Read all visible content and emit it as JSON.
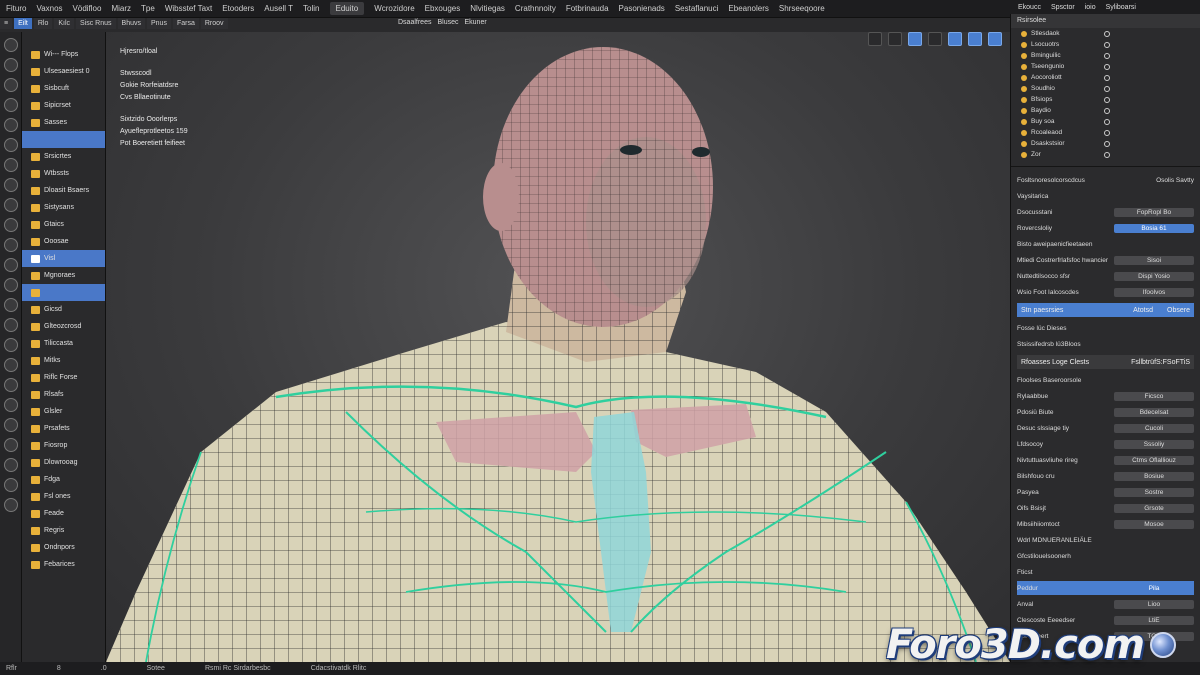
{
  "menubar": {
    "items": [
      "Fituro",
      "Vaxnos",
      "Vödifloo",
      "Miarz",
      "Tpe",
      "Wibsstef Taxt",
      "Etooders",
      "Ausell T",
      "Tolin",
      "Eduito",
      "Wcrozidore",
      "Ebxouges",
      "Nlvitiegas",
      "Crathnnoity",
      "Fotbrinauda",
      "Pasonienads",
      "Sestaflanuci",
      "Ebeanolers",
      "Shrseeqoore"
    ]
  },
  "toolbar2": {
    "tabs": [
      "≡",
      "Eilt",
      "Rlo",
      "Kılc",
      "Sisc Rnus",
      "Bhuvs",
      "Pnus",
      "Farsa",
      "Rroov"
    ],
    "header": [
      "Dsaalfrees",
      "Blusec",
      "Ekuner"
    ]
  },
  "viewport": {
    "text_block_1": [
      "Hjresro/tloal"
    ],
    "text_block_2": [
      "Stwsscodl",
      "Gokie Rorfeiatdsre",
      "Cvs Bllaeotinute"
    ],
    "text_block_3": [
      "Sixtzido Ooorlerps",
      "Ayuefleprotleetos 159",
      "Pot Boeretiett feifieet"
    ]
  },
  "outliner": {
    "items": [
      {
        "label": "Wi--- Flops",
        "state": "normal"
      },
      {
        "label": "Ulsesaesiest 0",
        "state": "normal"
      },
      {
        "label": "Sisbcuft",
        "state": "normal"
      },
      {
        "label": "Sipicrset",
        "state": "normal"
      },
      {
        "label": "Sasses",
        "state": "normal"
      },
      {
        "label": "",
        "state": "empty"
      },
      {
        "label": "Srsicrtes",
        "state": "normal"
      },
      {
        "label": "Wtbssts",
        "state": "normal"
      },
      {
        "label": "Dloasit Bsaers",
        "state": "normal"
      },
      {
        "label": "Sistysans",
        "state": "normal"
      },
      {
        "label": "Gtaics",
        "state": "normal"
      },
      {
        "label": "Ooosae",
        "state": "normal"
      },
      {
        "label": "Visl",
        "state": "selected"
      },
      {
        "label": "Mgnoraes",
        "state": "normal"
      },
      {
        "label": "",
        "state": "empty"
      },
      {
        "label": "Gicsd",
        "state": "normal"
      },
      {
        "label": "Glteozcrosd",
        "state": "normal"
      },
      {
        "label": "Tiliccasta",
        "state": "normal"
      },
      {
        "label": "Mitks",
        "state": "normal"
      },
      {
        "label": "Riflc Forse",
        "state": "normal"
      },
      {
        "label": "Rlsafs",
        "state": "normal"
      },
      {
        "label": "Glsler",
        "state": "normal"
      },
      {
        "label": "Prsafets",
        "state": "normal"
      },
      {
        "label": "Fiosrop",
        "state": "normal"
      },
      {
        "label": "Dlowrooag",
        "state": "normal"
      },
      {
        "label": "Fdga",
        "state": "normal"
      },
      {
        "label": "Fsl ones",
        "state": "normal"
      },
      {
        "label": "Feade",
        "state": "normal"
      },
      {
        "label": "Regris",
        "state": "normal"
      },
      {
        "label": "Ondnpors",
        "state": "normal"
      },
      {
        "label": "Febarices",
        "state": "normal"
      }
    ]
  },
  "rightpanel": {
    "top": [
      "Ekoucc",
      "Spsctor",
      "ioio",
      "Syliboarsi"
    ],
    "header": "Rsirsolee",
    "scene_items": [
      "Stlesdaok",
      "Lsocuotrs",
      "Bminguilic",
      "Tseengunio",
      "Aocoroliott",
      "Soudhio",
      "Bfsiops",
      "Baydio",
      "Buy soa",
      "Rcoaleaod",
      "Dsaskstsior",
      "Zor"
    ],
    "section_title_left": "Fosltsnoresolcorscdcus",
    "section_title_right": "Osolis Savtty",
    "props": [
      {
        "label": "Vaysitarica",
        "value": ""
      },
      {
        "label": "Dsocusstani",
        "value": "FopRopl Bo"
      },
      {
        "label": "Rovercsloliy",
        "value": "Bosia 61"
      },
      {
        "label": "Bisto aweipaenicfieetaeen",
        "value": ""
      },
      {
        "label": "Mtiedi Costrerfrlafsfoc hwancier",
        "value": "Sisoi"
      },
      {
        "label": "Nuttedtilsocco sfsr",
        "value": "Dispi Yosio"
      },
      {
        "label": "Wsio Foot Ialcoscdes",
        "value": "Ifoolvos"
      }
    ],
    "section_blue": {
      "label": "Stn paesrsies",
      "right": [
        "Atotsd",
        "Obsere"
      ]
    },
    "subsection": "Fosse lüc Dieses",
    "subsection2": "Stsissifedrsb lü3Bloos",
    "section_dark": {
      "label": "Rfoasses Loge Clests",
      "right": "FsllbtrüfS:FSoFTiS"
    },
    "props2_title": "Floolses Baseroorsole",
    "props2": [
      {
        "label": "Rylaabbue",
        "value": "Ficsco"
      },
      {
        "label": "Pdosiü Biute",
        "value": "Bdecelsat"
      },
      {
        "label": "Desuc slssiage tiy",
        "value": "Cucoli"
      },
      {
        "label": "Lfdsocoy",
        "value": "Sssoliy"
      },
      {
        "label": "Nivtuttuasvliuhe rireg",
        "value": "Ctms Oflalliouz"
      },
      {
        "label": "Bilshfouo cru",
        "value": "Bosiue"
      },
      {
        "label": "Pasyea",
        "value": "Sostre"
      },
      {
        "label": "Oifs Bsisjt",
        "value": "Grsote"
      },
      {
        "label": "Mibsiihiiomtoct",
        "value": "Mosoe"
      }
    ],
    "bottom_title": "Wdrl  MDNUERANLEIÄLE",
    "bottom_sub": "Gfcstilouelsoonerh",
    "bottom_sub2": "Fticst",
    "bottom_rows": [
      {
        "label": "Peddur",
        "value": "Pila",
        "blue": true
      },
      {
        "label": "Anval",
        "value": "Lioo",
        "blue": false
      },
      {
        "label": "Clescoste Eeeedser",
        "value": "LtiE",
        "blue": false
      },
      {
        "label": "Apt Ikneert",
        "value": "TOE",
        "blue": false
      }
    ]
  },
  "statusbar": {
    "items": [
      "Rflr",
      "8",
      ".0",
      "Sotee",
      "Rsmi Rc Sirdarbesbc",
      "Cdacstivatdk Rlitc"
    ]
  },
  "watermark": {
    "text": "Foro3D.com"
  },
  "colors": {
    "accent": "#4a7fd0",
    "folder": "#e8b13a",
    "panel": "#2b2b2d"
  }
}
